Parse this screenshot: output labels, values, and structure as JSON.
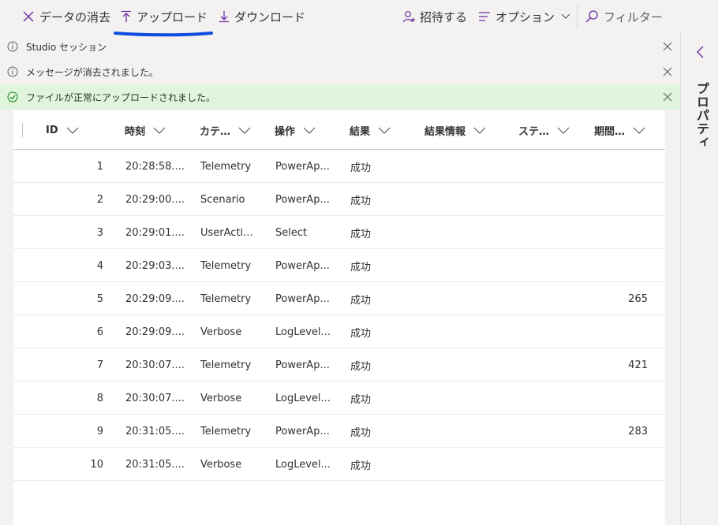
{
  "toolbar": {
    "clear_label": "データの消去",
    "upload_label": "アップロード",
    "download_label": "ダウンロード",
    "invite_label": "招待する",
    "options_label": "オプション",
    "filter_label": "フィルター",
    "icons": [
      "close-icon",
      "upload-arrow-icon",
      "download-arrow-icon",
      "invite-person-icon",
      "options-lines-icon",
      "chevron-down-icon",
      "search-icon"
    ],
    "accent_color": "#6b2fa3",
    "annotation_color": "#0f4de0"
  },
  "messages": [
    {
      "text": "Studio セッション",
      "type": "info"
    },
    {
      "text": "メッセージが消去されました。",
      "type": "info"
    },
    {
      "text": "ファイルが正常にアップロードされました。",
      "type": "success"
    }
  ],
  "properties_panel": {
    "label": "プロパティ"
  },
  "grid": {
    "columns": [
      "ID",
      "時刻",
      "カテ…",
      "操作",
      "結果",
      "結果情報",
      "ステ…",
      "期間…"
    ],
    "rows": [
      {
        "id": "1",
        "time": "20:28:58....",
        "category": "Telemetry",
        "operation": "PowerAp...",
        "result": "成功",
        "result_info": "",
        "status": "",
        "duration": ""
      },
      {
        "id": "2",
        "time": "20:29:00....",
        "category": "Scenario",
        "operation": "PowerAp...",
        "result": "成功",
        "result_info": "",
        "status": "",
        "duration": ""
      },
      {
        "id": "3",
        "time": "20:29:01....",
        "category": "UserActi...",
        "operation": "Select",
        "result": "成功",
        "result_info": "",
        "status": "",
        "duration": ""
      },
      {
        "id": "4",
        "time": "20:29:03....",
        "category": "Telemetry",
        "operation": "PowerAp...",
        "result": "成功",
        "result_info": "",
        "status": "",
        "duration": ""
      },
      {
        "id": "5",
        "time": "20:29:09....",
        "category": "Telemetry",
        "operation": "PowerAp...",
        "result": "成功",
        "result_info": "",
        "status": "",
        "duration": "265"
      },
      {
        "id": "6",
        "time": "20:29:09....",
        "category": "Verbose",
        "operation": "LogLevel...",
        "result": "成功",
        "result_info": "",
        "status": "",
        "duration": ""
      },
      {
        "id": "7",
        "time": "20:30:07....",
        "category": "Telemetry",
        "operation": "PowerAp...",
        "result": "成功",
        "result_info": "",
        "status": "",
        "duration": "421"
      },
      {
        "id": "8",
        "time": "20:30:07....",
        "category": "Verbose",
        "operation": "LogLevel...",
        "result": "成功",
        "result_info": "",
        "status": "",
        "duration": ""
      },
      {
        "id": "9",
        "time": "20:31:05....",
        "category": "Telemetry",
        "operation": "PowerAp...",
        "result": "成功",
        "result_info": "",
        "status": "",
        "duration": "283"
      },
      {
        "id": "10",
        "time": "20:31:05....",
        "category": "Verbose",
        "operation": "LogLevel...",
        "result": "成功",
        "result_info": "",
        "status": "",
        "duration": ""
      }
    ]
  }
}
